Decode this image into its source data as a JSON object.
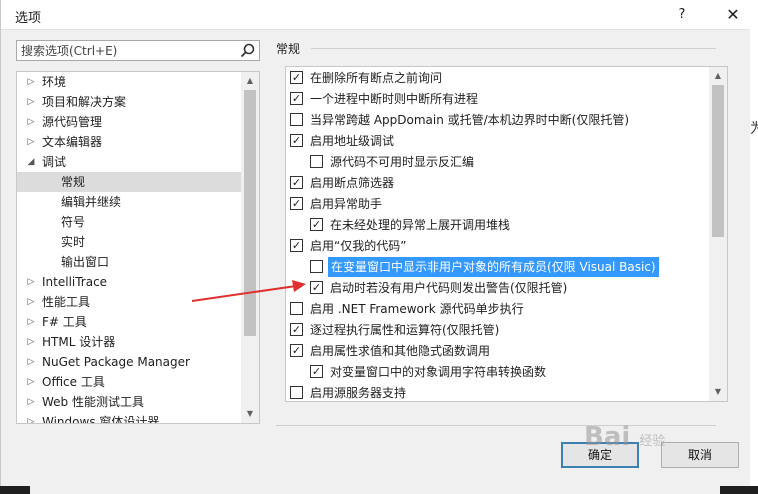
{
  "window": {
    "title": "选项",
    "help": "?",
    "close": "✕"
  },
  "search": {
    "placeholder": "搜索选项(Ctrl+E)"
  },
  "tree": {
    "items": [
      {
        "label": "环境",
        "arrow": "▷"
      },
      {
        "label": "项目和解决方案",
        "arrow": "▷"
      },
      {
        "label": "源代码管理",
        "arrow": "▷"
      },
      {
        "label": "文本编辑器",
        "arrow": "▷"
      },
      {
        "label": "调试",
        "arrow": "◢"
      },
      {
        "label": "常规",
        "arrow": ""
      },
      {
        "label": "编辑并继续",
        "arrow": ""
      },
      {
        "label": "符号",
        "arrow": ""
      },
      {
        "label": "实时",
        "arrow": ""
      },
      {
        "label": "输出窗口",
        "arrow": ""
      },
      {
        "label": "IntelliTrace",
        "arrow": "▷"
      },
      {
        "label": "性能工具",
        "arrow": "▷"
      },
      {
        "label": "F# 工具",
        "arrow": "▷"
      },
      {
        "label": "HTML 设计器",
        "arrow": "▷"
      },
      {
        "label": "NuGet Package Manager",
        "arrow": "▷"
      },
      {
        "label": "Office 工具",
        "arrow": "▷"
      },
      {
        "label": "Web 性能测试工具",
        "arrow": "▷"
      },
      {
        "label": "Windows 窗体设计器",
        "arrow": "▷"
      }
    ]
  },
  "section": {
    "title": "常规"
  },
  "options": [
    {
      "label": "在删除所有断点之前询问",
      "check": "✓"
    },
    {
      "label": "一个进程中断时则中断所有进程",
      "check": "✓"
    },
    {
      "label": "当异常跨越 AppDomain 或托管/本机边界时中断(仅限托管)",
      "check": ""
    },
    {
      "label": "启用地址级调试",
      "check": "✓"
    },
    {
      "label": "源代码不可用时显示反汇编",
      "check": ""
    },
    {
      "label": "启用断点筛选器",
      "check": "✓"
    },
    {
      "label": "启用异常助手",
      "check": "✓"
    },
    {
      "label": "在未经处理的异常上展开调用堆栈",
      "check": "✓"
    },
    {
      "label": "启用“仅我的代码”",
      "check": "✓"
    },
    {
      "label": "在变量窗口中显示非用户对象的所有成员(仅限 Visual Basic)",
      "check": ""
    },
    {
      "label": "启动时若没有用户代码则发出警告(仅限托管)",
      "check": "✓"
    },
    {
      "label": "启用 .NET Framework 源代码单步执行",
      "check": ""
    },
    {
      "label": "逐过程执行属性和运算符(仅限托管)",
      "check": "✓"
    },
    {
      "label": "启用属性求值和其他隐式函数调用",
      "check": "✓"
    },
    {
      "label": "对变量窗口中的对象调用字符串转换函数",
      "check": "✓"
    },
    {
      "label": "启用源服务器支持",
      "check": ""
    }
  ],
  "buttons": {
    "ok": "确定",
    "cancel": "取消"
  },
  "edge": {
    "peek": "为"
  },
  "watermark": {
    "text": "Bai",
    "sub": "经验"
  },
  "colors": {
    "highlight": "#3399ff",
    "annotation_arrow": "#e03030",
    "default_button_border": "#3c7fb1"
  }
}
